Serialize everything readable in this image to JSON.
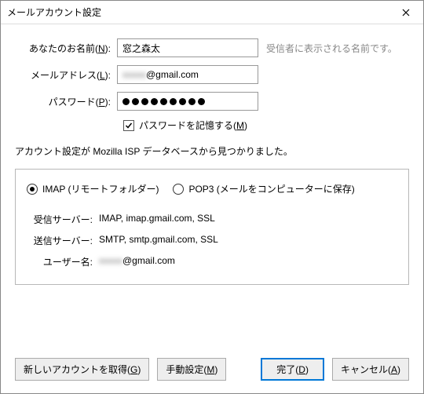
{
  "title": "メールアカウント設定",
  "form": {
    "name_label": "あなたのお名前",
    "name_key": "N",
    "name_value": "窓之森太",
    "name_hint": "受信者に表示される名前です。",
    "email_label": "メールアドレス",
    "email_key": "L",
    "email_value_obscured": "xxxxx",
    "email_value_domain": "@gmail.com",
    "password_label": "パスワード",
    "password_key": "P",
    "password_dots": 9,
    "remember_label": "パスワードを記憶する",
    "remember_key": "M",
    "remember_checked": true
  },
  "status": "アカウント設定が Mozilla ISP データベースから見つかりました。",
  "protocol": {
    "imap_label": "IMAP (リモートフォルダー)",
    "pop3_label": "POP3 (メールをコンピューターに保存)",
    "selected": "imap"
  },
  "servers": {
    "incoming_label": "受信サーバー:",
    "incoming_value": "IMAP, imap.gmail.com, SSL",
    "outgoing_label": "送信サーバー:",
    "outgoing_value": "SMTP, smtp.gmail.com, SSL",
    "user_label": "ユーザー名:",
    "user_obscured": "xxxxx",
    "user_domain": "@gmail.com"
  },
  "buttons": {
    "get_new": "新しいアカウントを取得",
    "get_new_key": "G",
    "manual": "手動設定",
    "manual_key": "M",
    "done": "完了",
    "done_key": "D",
    "cancel": "キャンセル",
    "cancel_key": "A"
  }
}
